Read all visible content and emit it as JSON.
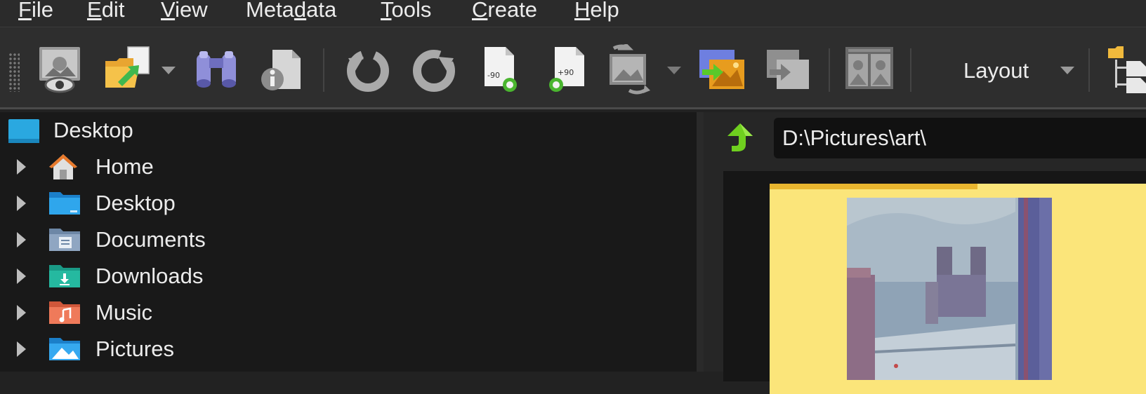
{
  "menu": {
    "file": {
      "accel": "F",
      "rest": "ile"
    },
    "edit": {
      "accel": "E",
      "rest": "dit"
    },
    "view": {
      "accel": "V",
      "rest": "iew"
    },
    "metadata": {
      "pre": "Meta",
      "accel": "d",
      "rest": "ata"
    },
    "tools": {
      "accel": "T",
      "rest": "ools"
    },
    "create": {
      "accel": "C",
      "rest": "reate"
    },
    "help": {
      "accel": "H",
      "rest": "elp"
    }
  },
  "toolbar": {
    "layout_label": "Layout",
    "rotate_left_badge": "-90",
    "rotate_right_badge": "+90"
  },
  "tree": {
    "root_label": "Desktop",
    "items": [
      {
        "label": "Home",
        "icon": "home-icon"
      },
      {
        "label": "Desktop",
        "icon": "desktop-folder-icon"
      },
      {
        "label": "Documents",
        "icon": "documents-folder-icon"
      },
      {
        "label": "Downloads",
        "icon": "downloads-folder-icon"
      },
      {
        "label": "Music",
        "icon": "music-folder-icon"
      },
      {
        "label": "Pictures",
        "icon": "pictures-folder-icon"
      }
    ]
  },
  "browser": {
    "path": "D:\\Pictures\\art\\"
  },
  "colors": {
    "menu_bg": "#2b2b2b",
    "tree_bg": "#191919",
    "text": "#ececec",
    "thumb_selected_bg": "#fbe57a"
  }
}
